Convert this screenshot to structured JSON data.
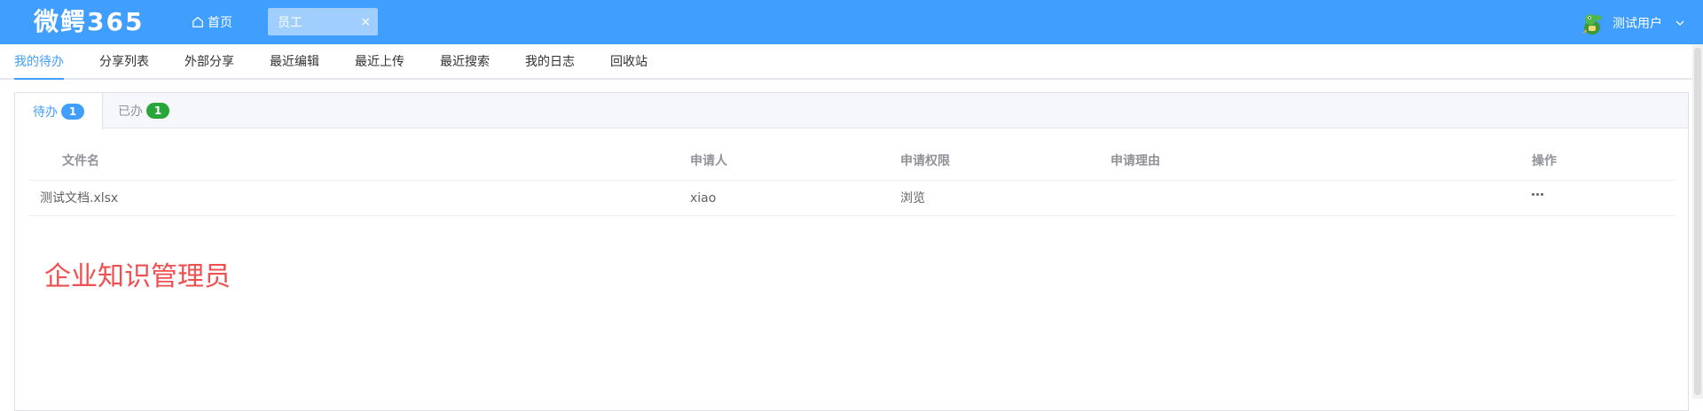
{
  "header": {
    "logo": "微鳄365",
    "home_label": "首页",
    "open_tab": {
      "label": "员工",
      "close": "×"
    },
    "user": {
      "name": "测试用户"
    }
  },
  "subnav": {
    "items": [
      {
        "label": "我的待办",
        "active": true
      },
      {
        "label": "分享列表"
      },
      {
        "label": "外部分享"
      },
      {
        "label": "最近编辑"
      },
      {
        "label": "最近上传"
      },
      {
        "label": "最近搜索"
      },
      {
        "label": "我的日志"
      },
      {
        "label": "回收站"
      }
    ]
  },
  "tabs": [
    {
      "label": "待办",
      "count": "1",
      "badge_color": "#409eff",
      "active": true
    },
    {
      "label": "已办",
      "count": "1",
      "badge_color": "#2aa53a"
    }
  ],
  "table": {
    "columns": [
      "文件名",
      "申请人",
      "申请权限",
      "申请理由",
      "操作"
    ],
    "rows": [
      {
        "file": "测试文档.xlsx",
        "applicant": "xiao",
        "permission": "浏览",
        "reason": ""
      }
    ]
  },
  "note": "企业知识管理员",
  "colors": {
    "primary": "#409eff",
    "success": "#2aa53a",
    "note": "#ef4f4f"
  }
}
